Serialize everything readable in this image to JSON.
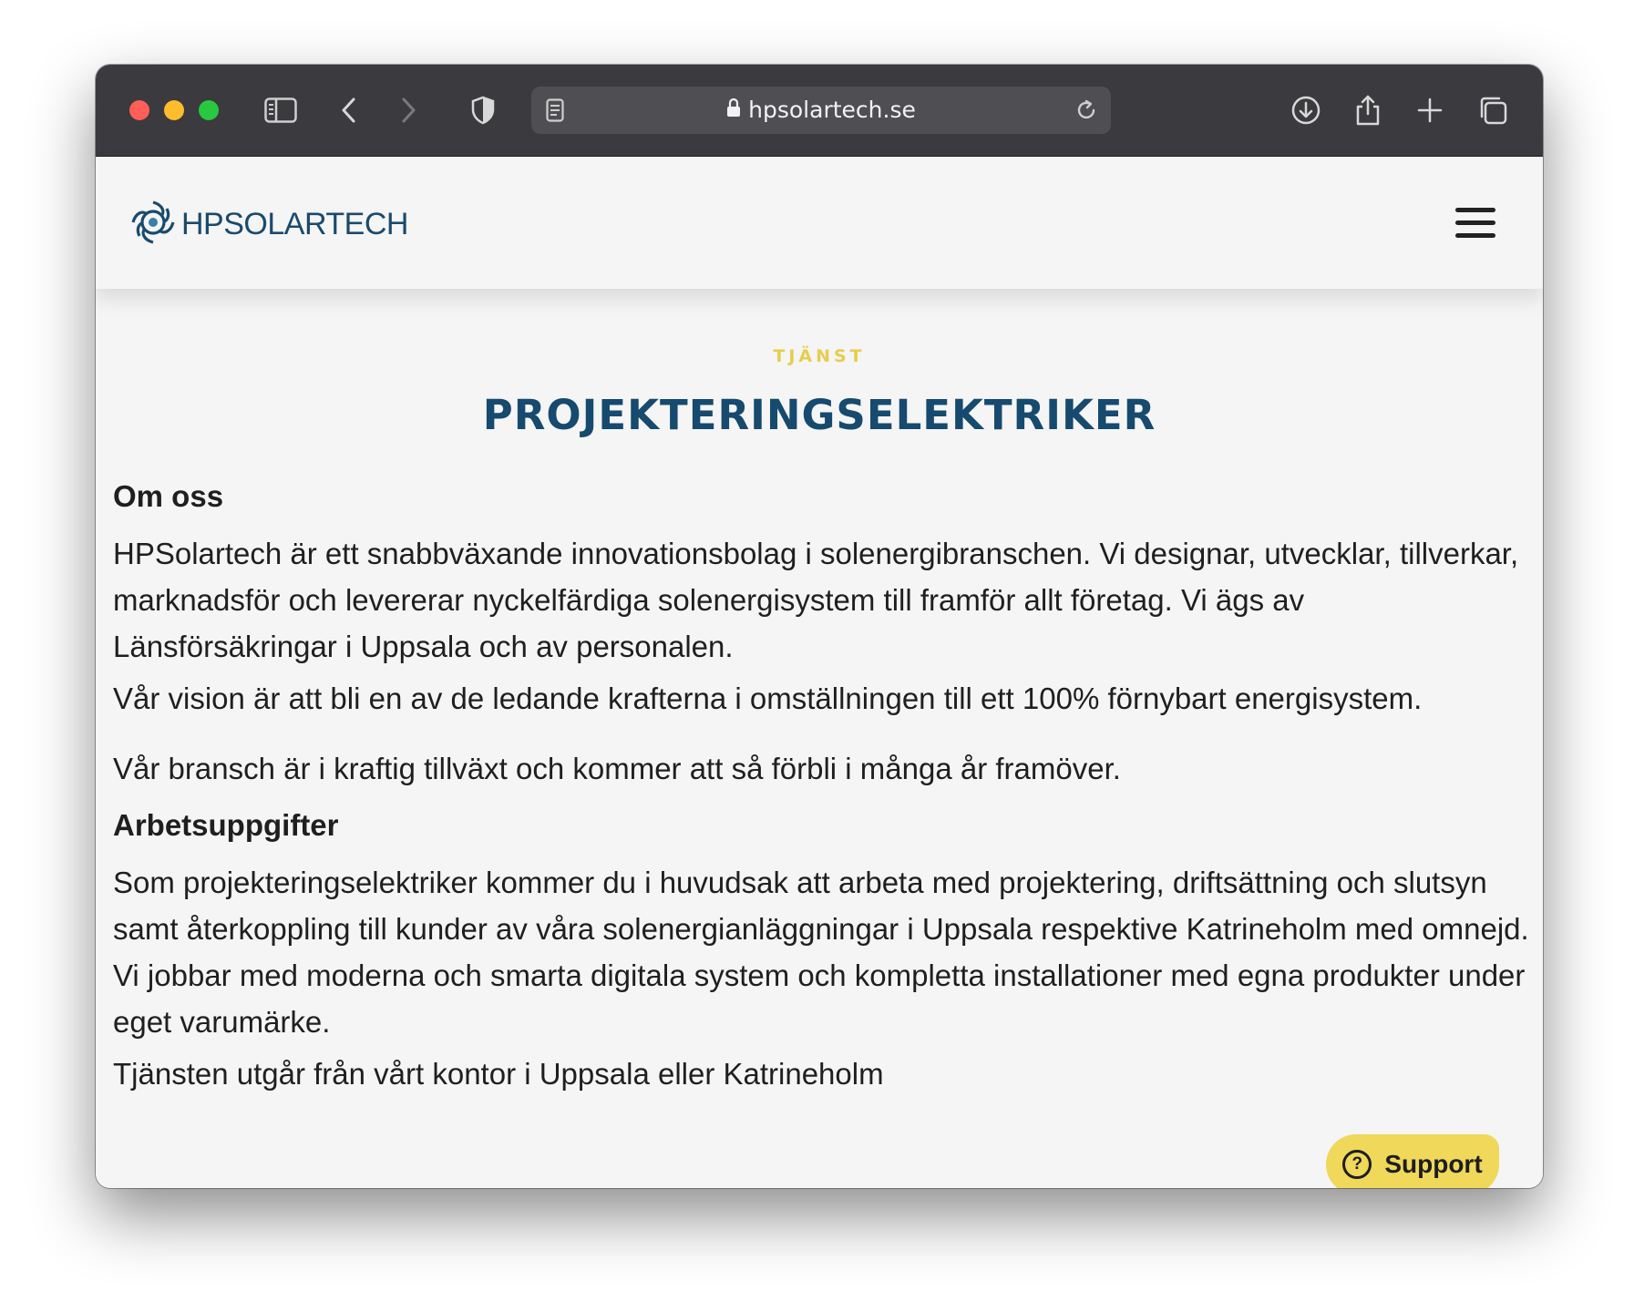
{
  "browser": {
    "url": "hpsolartech.se"
  },
  "site": {
    "logo_text": "HPSOLARTECH"
  },
  "article": {
    "eyebrow": "TJÄNST",
    "title": "PROJEKTERINGSELEKTRIKER",
    "sections": [
      {
        "heading": "Om oss"
      },
      {
        "para": "HPSolartech är ett snabbväxande innovationsbolag i solenergibranschen. Vi designar, utvecklar, tillverkar, marknadsför och levererar nyckelfärdiga solenergisystem till framför allt företag. Vi ägs av Länsförsäkringar i Uppsala och av personalen."
      },
      {
        "para": "Vår vision är att bli en av de ledande krafterna i omställningen till ett 100% förnybart energisystem."
      },
      {
        "para": "Vår bransch är i kraftig tillväxt och kommer att så förbli i många år framöver."
      },
      {
        "heading": "Arbetsuppgifter"
      },
      {
        "para": "Som projekteringselektriker kommer du i huvudsak att arbeta med projektering, driftsättning och slutsyn samt återkoppling till kunder av våra solenergianläggningar i Uppsala respektive Katrineholm med omnejd. Vi jobbar med moderna och smarta digitala system och kompletta installationer med egna produkter under eget varumärke."
      },
      {
        "para": "Tjänsten utgår från vårt kontor i Uppsala eller Katrineholm"
      }
    ]
  },
  "support_button": {
    "label": "Support",
    "icon": "?"
  },
  "colors": {
    "title": "#164a6e",
    "eyebrow": "#e8cd4c",
    "support_bg": "#efd85a"
  }
}
